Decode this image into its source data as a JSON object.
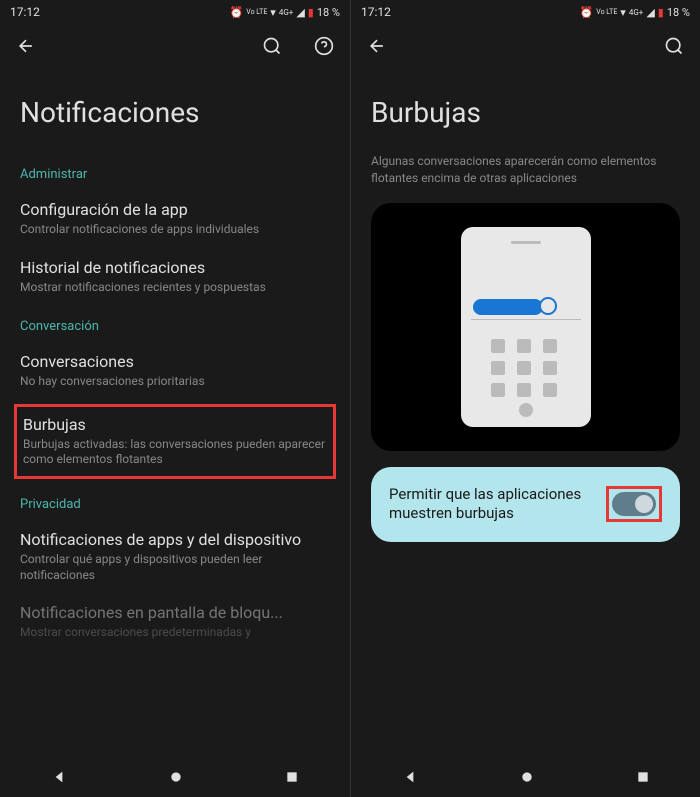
{
  "status": {
    "time": "17:12",
    "battery": "18 %",
    "network": "4G+",
    "lte": "Vo LTE"
  },
  "screen1": {
    "title": "Notificaciones",
    "sections": [
      {
        "header": "Administrar",
        "items": [
          {
            "title": "Configuración de la app",
            "subtitle": "Controlar notificaciones de apps individuales"
          },
          {
            "title": "Historial de notificaciones",
            "subtitle": "Mostrar notificaciones recientes y pospuestas"
          }
        ]
      },
      {
        "header": "Conversación",
        "items": [
          {
            "title": "Conversaciones",
            "subtitle": "No hay conversaciones prioritarias"
          },
          {
            "title": "Burbujas",
            "subtitle": "Burbujas activadas: las conversaciones pueden aparecer como elementos flotantes",
            "highlighted": true
          }
        ]
      },
      {
        "header": "Privacidad",
        "items": [
          {
            "title": "Notificaciones de apps y del dispositivo",
            "subtitle": "Controlar qué apps y dispositivos pueden leer notificaciones"
          },
          {
            "title": "Notificaciones en pantalla de bloqu...",
            "subtitle": "Mostrar conversaciones predeterminadas y",
            "faded": true
          }
        ]
      }
    ]
  },
  "screen2": {
    "title": "Burbujas",
    "description": "Algunas conversaciones aparecerán como elementos flotantes encima de otras aplicaciones",
    "toggle": {
      "label": "Permitir que las aplicaciones muestren burbujas",
      "on": true
    }
  }
}
